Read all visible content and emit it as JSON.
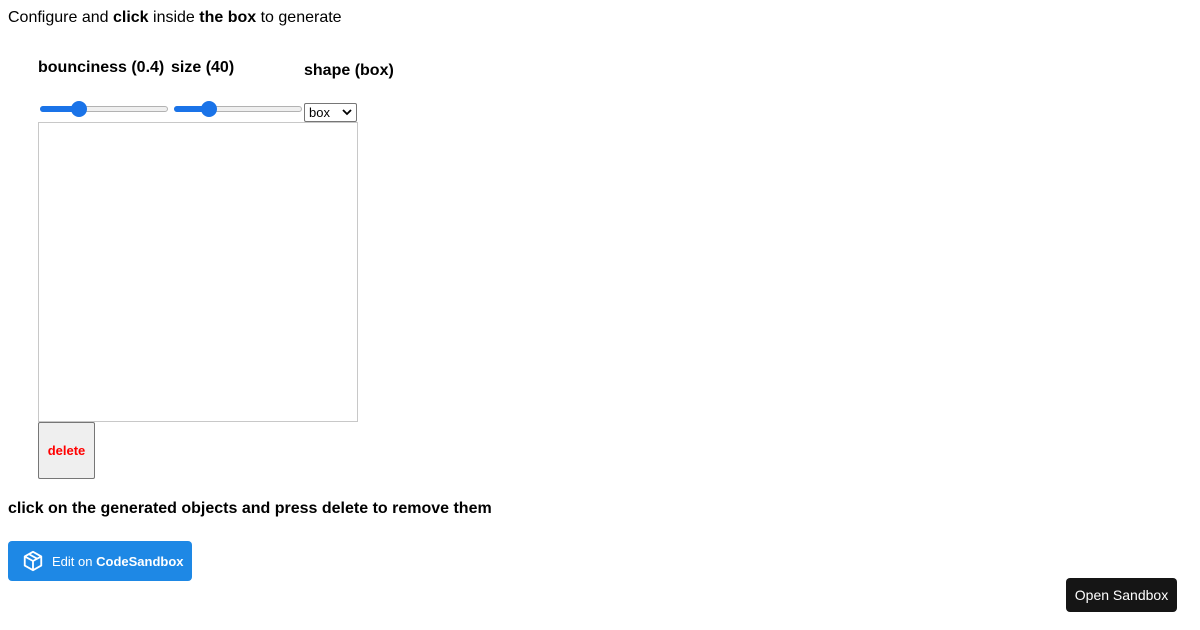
{
  "intro": {
    "part1": "Configure and ",
    "bold1": "click",
    "part2": " inside ",
    "bold2": "the box",
    "part3": " to generate"
  },
  "controls": {
    "bounciness_label": "bounciness (0.4)",
    "bounciness_value": 0.4,
    "size_label": "size (40)",
    "size_value": 40,
    "shape_label": "shape (box)",
    "shape_selected": "box",
    "accent_color": "#1a73e8"
  },
  "delete_button": {
    "label": "delete",
    "color": "#ff0000"
  },
  "instructions": "click on the generated objects and press delete to remove them",
  "codesandbox_button": {
    "prefix": "Edit on ",
    "brand": "CodeSandbox",
    "icon": "codesandbox-cube-icon",
    "color": "#1e88e5"
  },
  "open_sandbox_button": {
    "label": "Open Sandbox"
  }
}
